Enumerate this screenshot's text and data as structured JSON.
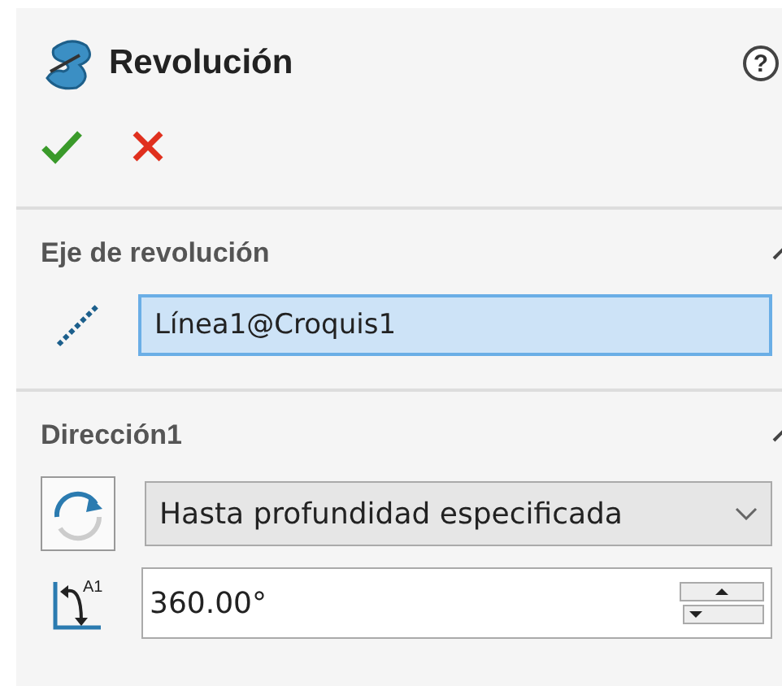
{
  "header": {
    "title": "Revolución",
    "help": "?"
  },
  "sections": [
    {
      "title": "Eje de revolución",
      "expanded": true,
      "rows": [
        {
          "kind": "selection",
          "value": "Línea1@Croquis1",
          "selected": true
        }
      ]
    },
    {
      "title": "Dirección1",
      "expanded": true,
      "rows": [
        {
          "kind": "dropdown",
          "value": "Hasta profundidad especificada"
        },
        {
          "kind": "spinner",
          "symbol": "A1",
          "value": "360.00°"
        }
      ]
    }
  ]
}
